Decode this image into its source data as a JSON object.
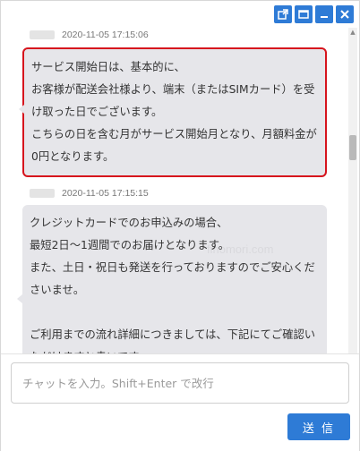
{
  "window": {
    "controls": [
      {
        "name": "popout-icon"
      },
      {
        "name": "maximize-icon"
      },
      {
        "name": "minimize-icon"
      },
      {
        "name": "close-icon"
      }
    ]
  },
  "messages": [
    {
      "timestamp": "2020-11-05 17:15:06",
      "text": "サービス開始日は、基本的に、\nお客様が配送会社様より、端末（またはSIMカード）を受け取った日でございます。\nこちらの日を含む月がサービス開始月となり、月額料金が0円となります。"
    },
    {
      "timestamp": "2020-11-05 17:15:15",
      "text": "クレジットカードでのお申込みの場合、\n最短2日～1週間でのお届けとなります。\nまた、土日・祝日も発送を行っておりますのでご安心くださいませ。\n\nご利用までの流れ詳細につきましては、下記にてご確認いただけますと幸いです。"
    }
  ],
  "watermark": "finomori.com",
  "composer": {
    "placeholder": "チャットを入力。Shift+Enter で改行",
    "send_label": "送 信"
  },
  "colors": {
    "accent": "#2e7bd6",
    "bubble": "#e6e6ea",
    "highlight": "#d6141d"
  }
}
